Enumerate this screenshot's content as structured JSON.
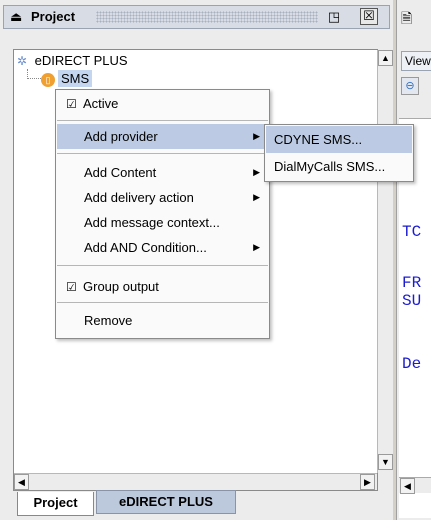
{
  "panel": {
    "title": "Project",
    "float_icon": "◳",
    "close_icon": "☒"
  },
  "tree": {
    "root_label": "eDIRECT PLUS",
    "child_label": "SMS"
  },
  "context_menu": {
    "items": [
      {
        "label": "Active",
        "checked": true
      },
      {
        "label": "Add provider",
        "has_submenu": true,
        "highlighted": true
      },
      {
        "label": "Add Content",
        "has_submenu": true
      },
      {
        "label": "Add delivery action",
        "has_submenu": true
      },
      {
        "label": "Add message context..."
      },
      {
        "label": "Add AND Condition...",
        "has_submenu": true
      },
      {
        "label": "Group output",
        "checked": true
      },
      {
        "label": "Remove"
      }
    ],
    "check_glyph": "☑",
    "arrow_glyph": "▶"
  },
  "submenu": {
    "items": [
      {
        "label": "CDYNE SMS...",
        "highlighted": true
      },
      {
        "label": "DialMyCalls SMS..."
      }
    ]
  },
  "bottom_tabs": {
    "project": "Project",
    "edirect": "eDIRECT PLUS"
  },
  "editor": {
    "view_label": "View",
    "code_lines": [
      "TC",
      "FR",
      "SU",
      "De"
    ]
  },
  "colors": {
    "selection": "#bccbe3",
    "code_text": "#1b1bd0",
    "node_icon": "#f0a030"
  },
  "icons": {
    "title": "printer-icon",
    "root": "gear-network-icon",
    "sms": "sms-node-icon",
    "editor": "document-icon",
    "zoom": "zoom-icon"
  }
}
